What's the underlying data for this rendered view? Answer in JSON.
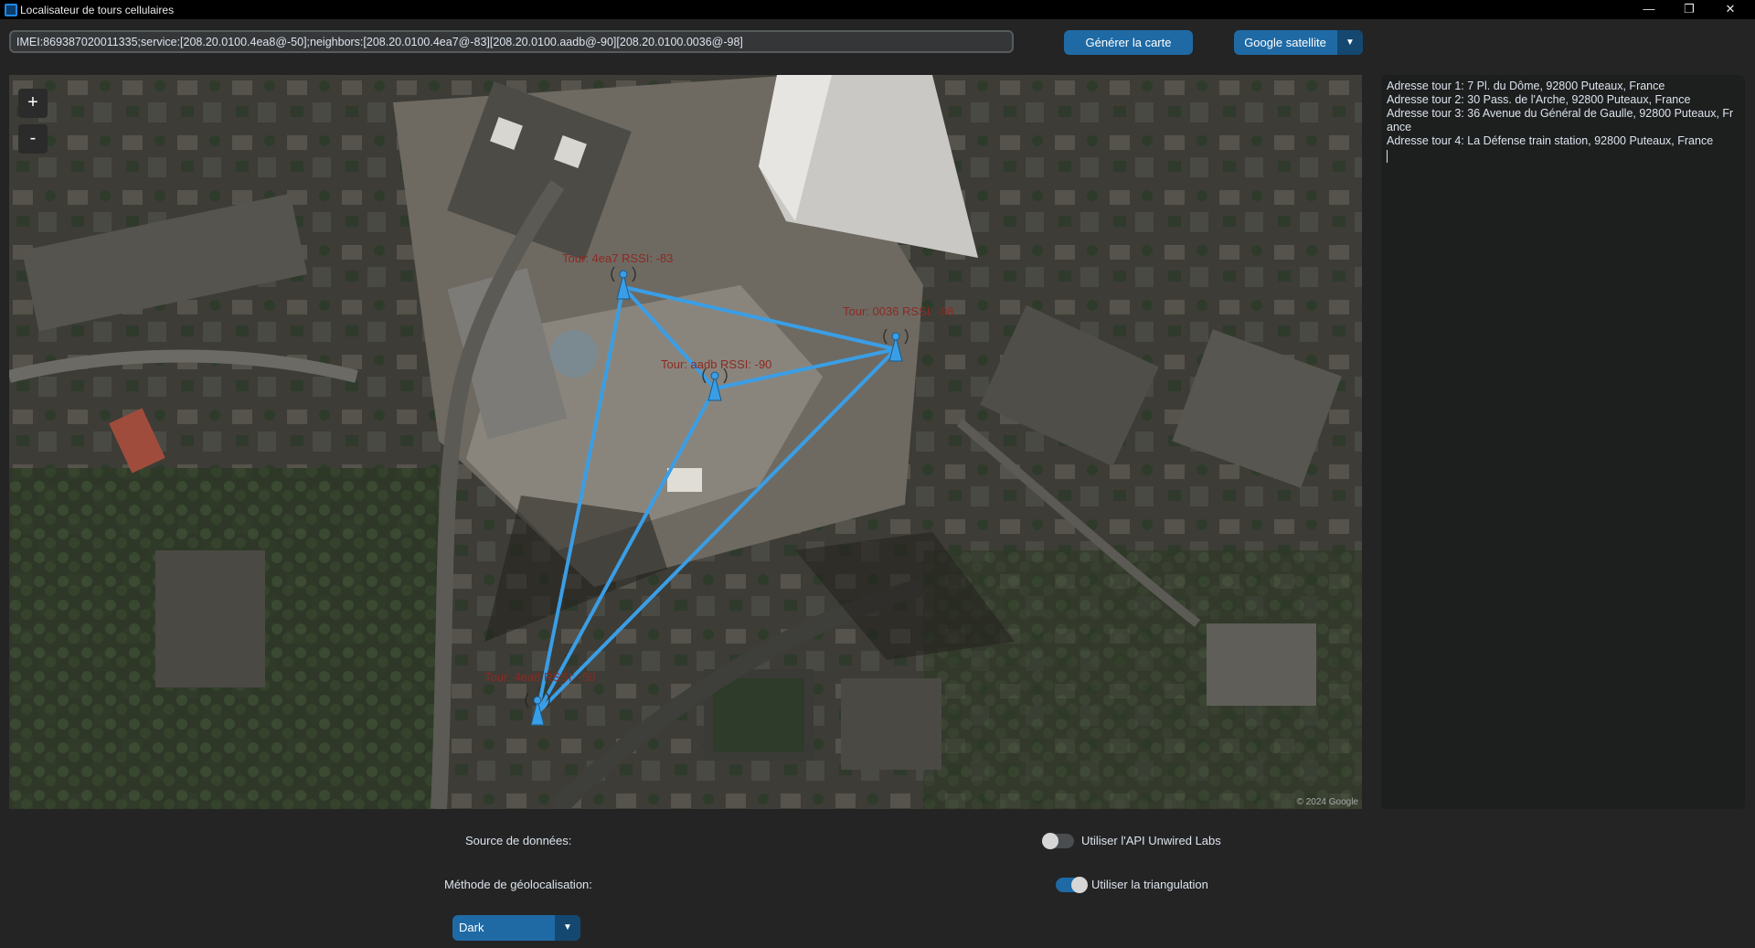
{
  "window": {
    "title": "Localisateur de tours cellulaires",
    "minimize": "—",
    "restore": "❐",
    "close": "✕"
  },
  "toolbar": {
    "imei_value": "IMEI:869387020011335;service:[208.20.0100.4ea8@-50];neighbors:[208.20.0100.4ea7@-83][208.20.0100.aadb@-90][208.20.0100.0036@-98]",
    "generate_label": "Générer la carte",
    "map_type": "Google satellite",
    "dropdown_arrow": "⌄"
  },
  "map": {
    "zoom_in": "+",
    "zoom_out": "-",
    "attribution": "© 2024 Google",
    "line_color": "#3a9ee6",
    "towers": [
      {
        "label": "Tour: 4ea7 RSSI: -83"
      },
      {
        "label": "Tour: 0036 RSSI: -98"
      },
      {
        "label": "Tour: aadb RSSI: -90"
      },
      {
        "label": "Tour: 4ea8 RSSI: -50"
      }
    ]
  },
  "info": {
    "lines": [
      "Adresse tour 1: 7 Pl. du Dôme, 92800 Puteaux, France",
      "Adresse tour 2: 30 Pass. de l'Arche, 92800 Puteaux, France",
      "Adresse tour 3: 36 Avenue du Général de Gaulle, 92800 Puteaux, France",
      "Adresse tour 4: La Défense train station, 92800 Puteaux, France"
    ]
  },
  "controls": {
    "source_label": "Source de données:",
    "geo_label": "Méthode de géolocalisation:",
    "api_label": "Utiliser l'API Unwired Labs",
    "api_on": false,
    "triangulation_label": "Utiliser la triangulation",
    "triangulation_on": true,
    "theme_value": "Dark"
  }
}
